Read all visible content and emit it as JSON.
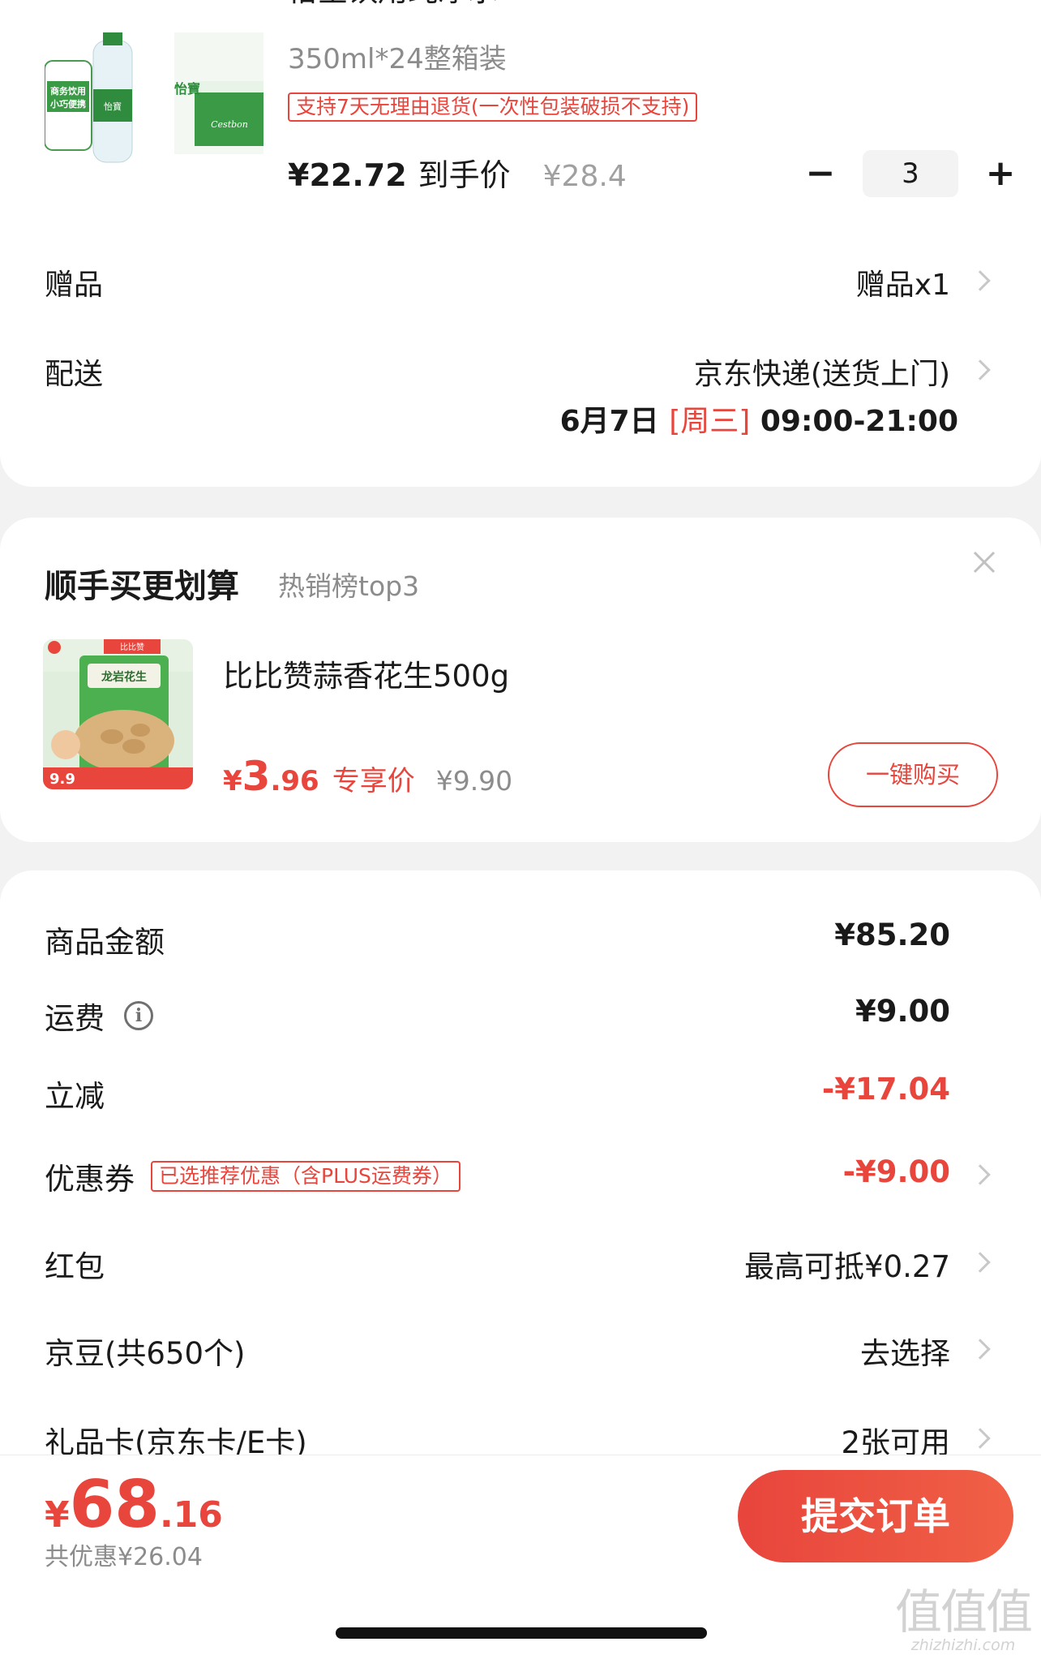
{
  "product": {
    "title": "怡宝饮用纯净水",
    "spec": "350ml*24整箱装",
    "return_policy": "支持7天无理由退货(一次性包装破损不支持)",
    "price": "¥22.72",
    "price_label": "到手价",
    "original_price": "¥28.4",
    "quantity": "3",
    "minus_label": "−",
    "plus_label": "+",
    "image_text": {
      "brand": "怡寶",
      "slogan_line1": "商务饮用",
      "slogan_line2": "小巧便携",
      "box_label": "Cestbon"
    }
  },
  "gift": {
    "label": "赠品",
    "value": "赠品x1"
  },
  "delivery": {
    "label": "配送",
    "method": "京东快递(送货上门)",
    "date": "6月7日",
    "weekday": "[周三]",
    "time": "09:00-21:00"
  },
  "upsell": {
    "title": "顺手买更划算",
    "subtitle": "热销榜top3",
    "item": {
      "name": "比比赞蒜香花生500g",
      "price_currency": "¥",
      "price_int": "3",
      "price_dec": ".96",
      "price_label": "专享价",
      "original_price": "¥9.90",
      "buy_label": "一键购买",
      "image_text": {
        "brand": "比比赞",
        "name": "龙岩花生",
        "promo": "9.9"
      }
    }
  },
  "summary": {
    "goods_label": "商品金额",
    "goods_value": "¥85.20",
    "shipping_label": "运费",
    "shipping_value": "¥9.00",
    "discount_label": "立减",
    "discount_value": "-¥17.04",
    "coupon_label": "优惠券",
    "coupon_tag": "已选推荐优惠（含PLUS运费券）",
    "coupon_value": "-¥9.00",
    "redpacket_label": "红包",
    "redpacket_value": "最高可抵¥0.27",
    "beans_label": "京豆(共650个)",
    "beans_value": "去选择",
    "giftcard_label": "礼品卡(京东卡/E卡)",
    "giftcard_value": "2张可用"
  },
  "footer": {
    "total_currency": "¥",
    "total_int": "68",
    "total_dec": ".16",
    "saved": "共优惠¥26.04",
    "submit_label": "提交订单"
  },
  "watermark": {
    "big": "值值值",
    "small": "zhizhizhi.com"
  },
  "colors": {
    "accent": "#e8453c",
    "text": "#1a1a1a",
    "muted": "#8c8c8c",
    "background": "#f2f2f2"
  }
}
